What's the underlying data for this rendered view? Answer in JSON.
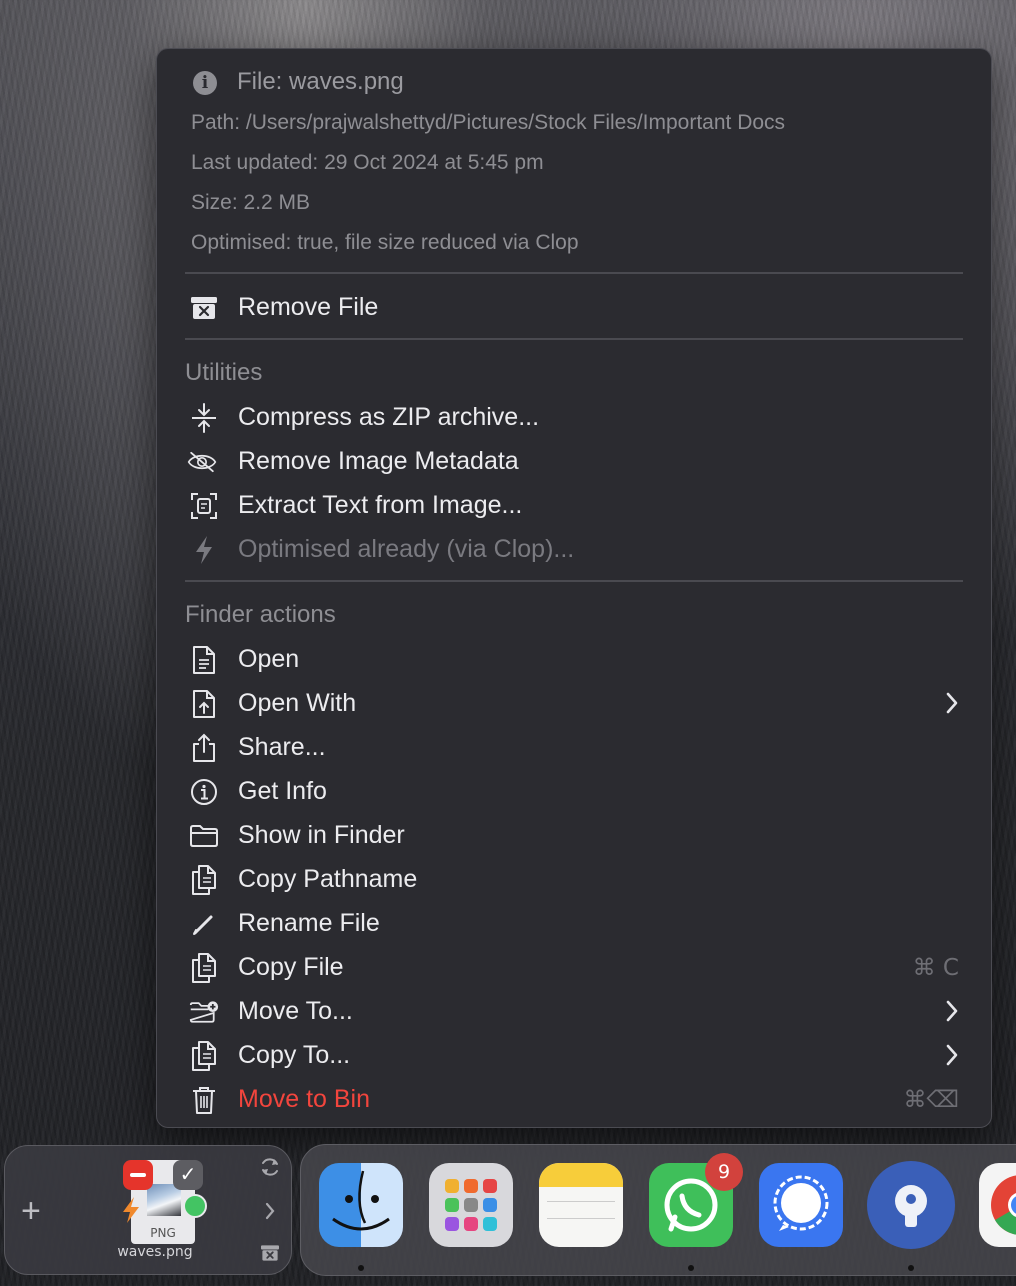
{
  "file_info": {
    "title": "File: waves.png",
    "path": "Path: /Users/prajwalshettyd/Pictures/Stock Files/Important Docs",
    "updated": "Last updated: 29 Oct 2024 at 5:45 pm",
    "size": "Size: 2.2 MB",
    "optimised": "Optimised: true, file size reduced via Clop"
  },
  "remove_file": "Remove File",
  "utilities": {
    "header": "Utilities",
    "items": [
      {
        "label": "Compress as ZIP archive...",
        "icon": "compress-icon"
      },
      {
        "label": "Remove Image Metadata",
        "icon": "eye-slash-icon"
      },
      {
        "label": "Extract Text from Image...",
        "icon": "text-scan-icon"
      },
      {
        "label": "Optimised already (via Clop)...",
        "icon": "bolt-icon",
        "disabled": true
      }
    ]
  },
  "finder_actions": {
    "header": "Finder actions",
    "items": [
      {
        "label": "Open",
        "icon": "document-icon"
      },
      {
        "label": "Open With",
        "icon": "document-arrow-icon",
        "submenu": true
      },
      {
        "label": "Share...",
        "icon": "share-icon"
      },
      {
        "label": "Get Info",
        "icon": "info-circle-icon"
      },
      {
        "label": "Show in Finder",
        "icon": "folder-icon"
      },
      {
        "label": "Copy Pathname",
        "icon": "copy-docs-icon"
      },
      {
        "label": "Rename File",
        "icon": "pencil-icon"
      },
      {
        "label": "Copy File",
        "icon": "copy-docs-icon",
        "shortcut": "⌘ C"
      },
      {
        "label": "Move To...",
        "icon": "folder-plus-icon",
        "submenu": true
      },
      {
        "label": "Copy To...",
        "icon": "copy-docs-icon",
        "submenu": true
      },
      {
        "label": "Move to Bin",
        "icon": "trash-icon",
        "shortcut": "⌘⌫",
        "danger": true
      }
    ]
  },
  "shelf": {
    "file_name": "waves.png",
    "file_ext": "PNG",
    "plus": "+"
  },
  "dock": {
    "apps": [
      "Finder",
      "Launchpad",
      "Notes",
      "WhatsApp",
      "Signal",
      "Proton Pass",
      "Chrome"
    ],
    "whatsapp_badge": "9"
  },
  "colors": {
    "menu_bg": "#2b2b30",
    "danger": "#f2453d",
    "text": "#ececef",
    "muted": "#8e8e93"
  }
}
